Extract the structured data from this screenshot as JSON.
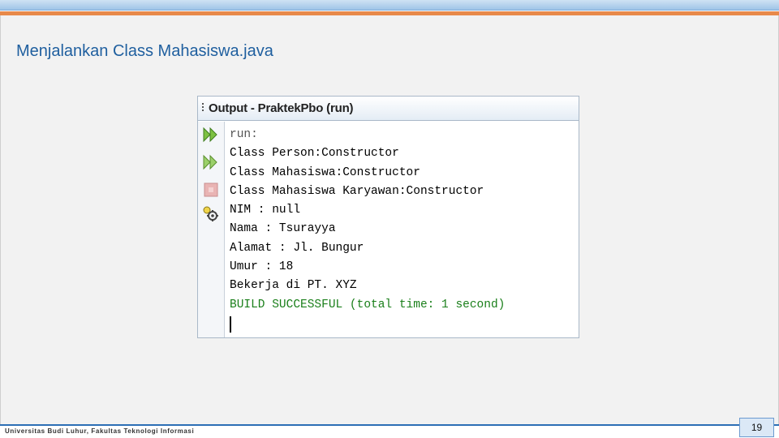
{
  "slide": {
    "title": "Menjalankan Class Mahasiswa.java",
    "page_number": "19",
    "footer": "Universitas Budi Luhur, Fakultas Teknologi Informasi"
  },
  "output_panel": {
    "title": "Output - PraktekPbo (run)",
    "toolbar": [
      {
        "name": "rerun-icon"
      },
      {
        "name": "rerun-with-params-icon"
      },
      {
        "name": "stop-icon"
      },
      {
        "name": "settings-icon"
      }
    ],
    "lines": [
      {
        "text": "run:",
        "style": "gray"
      },
      {
        "text": "Class Person:Constructor",
        "style": "normal"
      },
      {
        "text": "Class Mahasiswa:Constructor",
        "style": "normal"
      },
      {
        "text": "Class Mahasiswa Karyawan:Constructor",
        "style": "normal"
      },
      {
        "text": "NIM : null",
        "style": "normal"
      },
      {
        "text": "Nama : Tsurayya",
        "style": "normal"
      },
      {
        "text": "Alamat : Jl. Bungur",
        "style": "normal"
      },
      {
        "text": "Umur : 18",
        "style": "normal"
      },
      {
        "text": "Bekerja di PT. XYZ",
        "style": "normal"
      },
      {
        "text": "BUILD SUCCESSFUL (total time: 1 second)",
        "style": "green"
      }
    ]
  },
  "colors": {
    "title": "#1f5f9f",
    "accent_orange": "#e8894a",
    "build_success": "#1a7f1a"
  }
}
